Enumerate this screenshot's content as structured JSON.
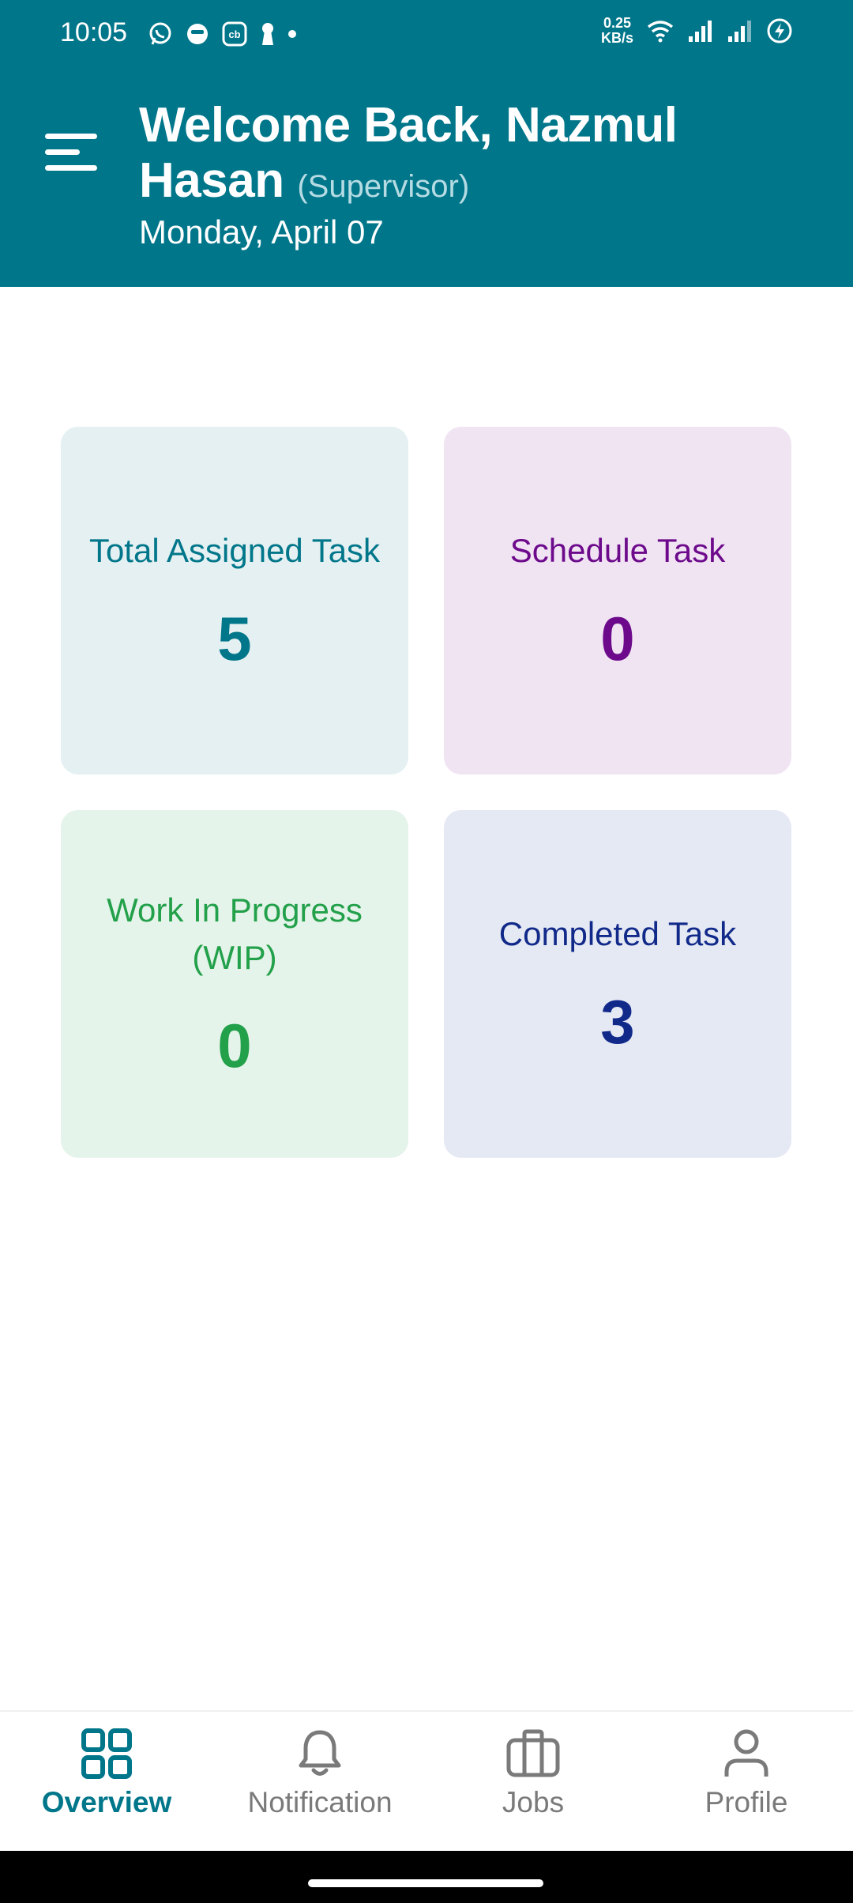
{
  "status_bar": {
    "time": "10:05",
    "net_speed_value": "0.25",
    "net_speed_unit": "KB/s",
    "left_icons": [
      "whatsapp-icon",
      "messenger-icon",
      "cb-app-icon",
      "keyhole-icon",
      "dot-icon"
    ],
    "right_icons": [
      "wifi-icon",
      "signal-icon",
      "signal-icon-2",
      "battery-charging-icon"
    ]
  },
  "header": {
    "welcome": "Welcome Back, Nazmul Hasan",
    "role": "(Supervisor)",
    "date": "Monday, April 07",
    "menu_icon": "menu-icon",
    "color": "#00768a"
  },
  "cards": {
    "total_assigned": {
      "label": "Total Assigned Task",
      "value": "5",
      "color": "#00768a"
    },
    "schedule": {
      "label": "Schedule Task",
      "value": "0",
      "color": "#6d0a8c"
    },
    "wip": {
      "label": "Work In Progress (WIP)",
      "value": "0",
      "color": "#22a04a"
    },
    "completed": {
      "label": "Completed Task",
      "value": "3",
      "color": "#112a8a"
    }
  },
  "bottom_nav": {
    "items": [
      {
        "label": "Overview",
        "icon": "grid-icon",
        "active": true
      },
      {
        "label": "Notification",
        "icon": "bell-icon",
        "active": false
      },
      {
        "label": "Jobs",
        "icon": "briefcase-icon",
        "active": false
      },
      {
        "label": "Profile",
        "icon": "person-icon",
        "active": false
      }
    ]
  }
}
